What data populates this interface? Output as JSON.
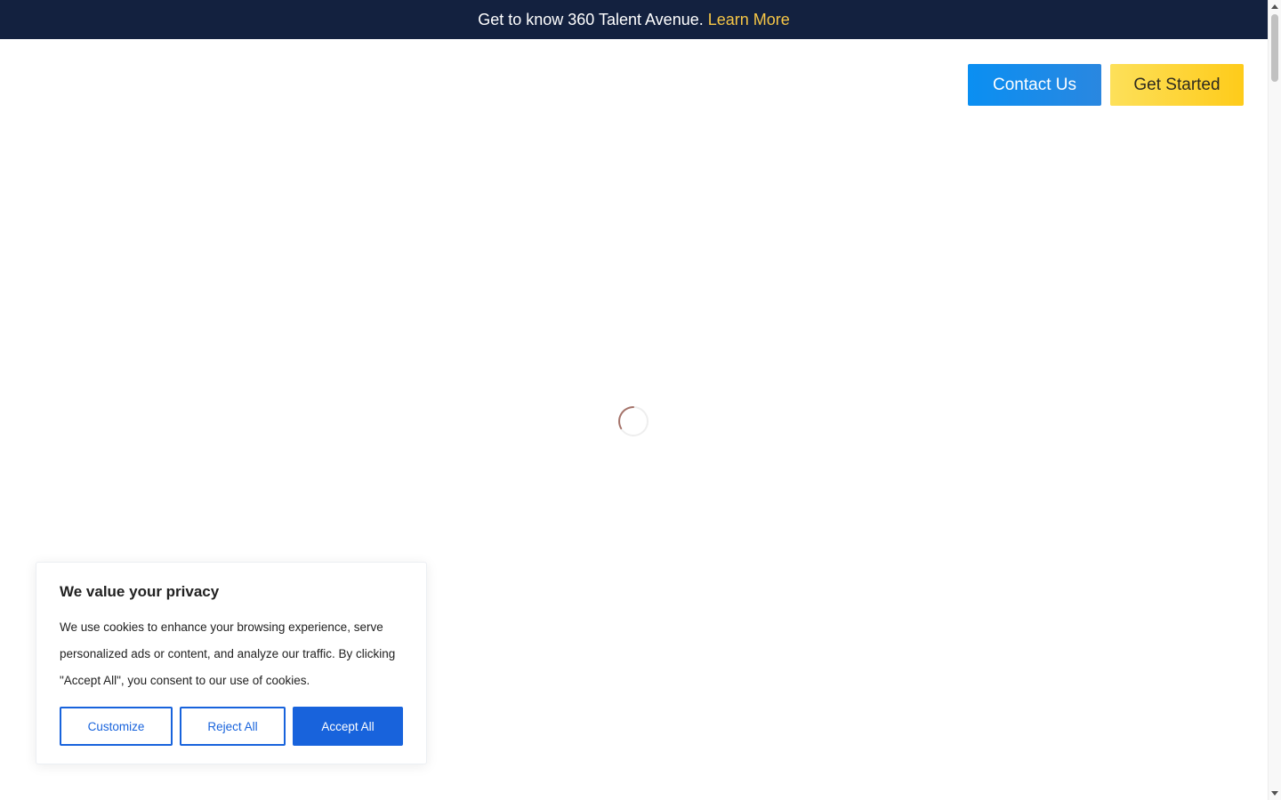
{
  "announcement": {
    "text": "Get to know 360 Talent Avenue.",
    "link_label": "Learn More"
  },
  "header": {
    "contact_label": "Contact Us",
    "get_started_label": "Get Started"
  },
  "loader": {
    "icon": "loading-spinner-icon"
  },
  "cookie_banner": {
    "title": "We value your privacy",
    "body": "We use cookies to enhance your browsing experience, serve personalized ads or content, and analyze our traffic. By clicking \"Accept All\", you consent to our use of cookies.",
    "customize_label": "Customize",
    "reject_label": "Reject All",
    "accept_label": "Accept All"
  },
  "colors": {
    "announce_bg": "#13213f",
    "link": "#f6c646",
    "contact_bg": "#0a8ff2",
    "get_started_bg": "#fecb1a",
    "cookie_accent": "#1863dc"
  }
}
